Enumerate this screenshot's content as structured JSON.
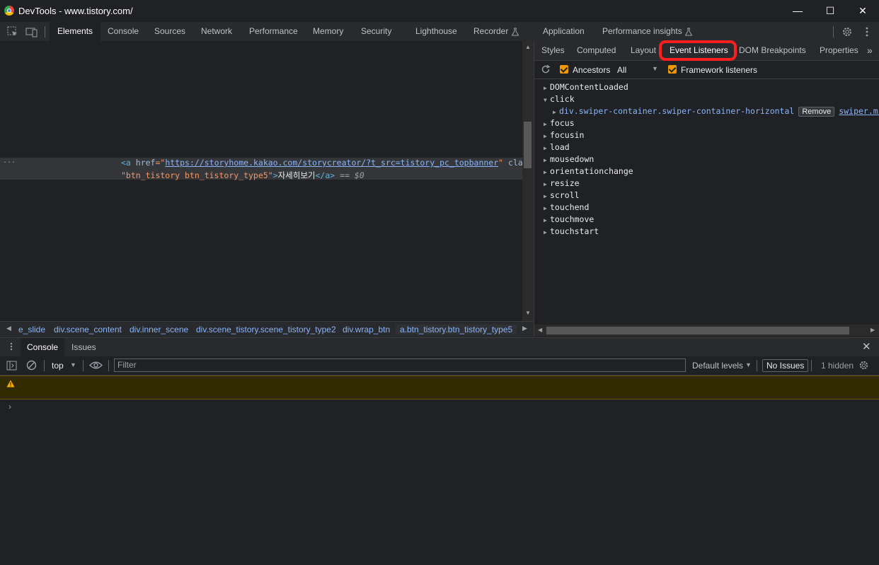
{
  "window": {
    "title": "DevTools - www.tistory.com/",
    "minimize": "—",
    "maximize": "☐",
    "close": "✕"
  },
  "main_tabs": [
    "Elements",
    "Console",
    "Sources",
    "Network",
    "Performance",
    "Memory",
    "Security",
    "Lighthouse",
    "Recorder",
    "Application",
    "Performance insights"
  ],
  "elements": {
    "ellipsis": "...",
    "line1": {
      "open": "<a ",
      "href_attr": "href",
      "eq": "=\"",
      "href_val": "https://storyhome.kakao.com/storycreator/?t_src=tistory_pc_topbanner",
      "close_quote": "\" ",
      "class_attr": "class="
    },
    "line2": {
      "class_val": "\"btn_tistory btn_tistory_type5\"",
      "gt": ">",
      "text": "자세히보기",
      "end_tag": "</a>",
      "eq0": " == $0"
    }
  },
  "breadcrumb": [
    "e_slide",
    "div.scene_content",
    "div.inner_scene",
    "div.scene_tistory.scene_tistory_type2",
    "div.wrap_btn",
    "a.btn_tistory.btn_tistory_type5"
  ],
  "sidebar": {
    "tabs": [
      "Styles",
      "Computed",
      "Layout",
      "Event Listeners",
      "DOM Breakpoints",
      "Properties"
    ],
    "ancestors_label": "Ancestors",
    "ancestors_value": "All",
    "framework_label": "Framework listeners",
    "events": [
      "DOMContentLoaded",
      "click",
      "focus",
      "focusin",
      "load",
      "mousedown",
      "orientationchange",
      "resize",
      "scroll",
      "touchend",
      "touchmove",
      "touchstart"
    ],
    "click_listener": {
      "node": "div.swiper-container.swiper-container-horizontal",
      "remove": "Remove",
      "source": "swiper.min.j"
    }
  },
  "drawer": {
    "tabs": [
      "Console",
      "Issues"
    ],
    "context": "top",
    "filter_placeholder": "Filter",
    "levels": "Default levels",
    "issues": "No Issues",
    "hidden": "1 hidden",
    "prompt": "›"
  },
  "colors": {
    "highlight": "#ff1e1e",
    "link": "#8ab4f8",
    "warning_bg": "#332b00"
  }
}
